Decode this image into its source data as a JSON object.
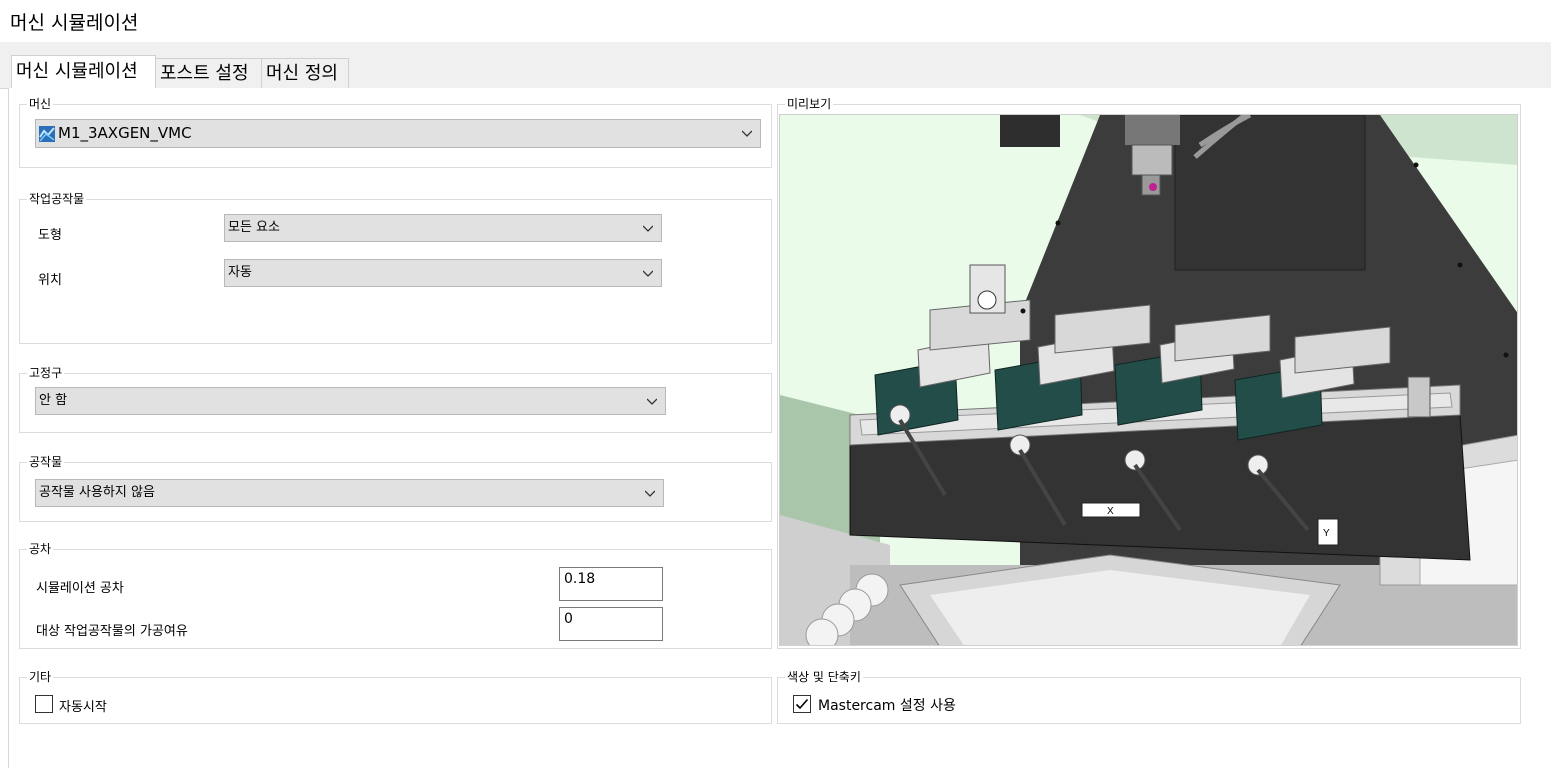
{
  "window": {
    "title": "머신 시뮬레이션"
  },
  "tabs": [
    {
      "label": "머신 시뮬레이션",
      "active": true
    },
    {
      "label": "포스트 설정",
      "active": false
    },
    {
      "label": "머신 정의",
      "active": false
    }
  ],
  "machine": {
    "group_label": "머신",
    "selected": "M1_3AXGEN_VMC",
    "icon": "machine-icon"
  },
  "workpiece": {
    "group_label": "작업공작물",
    "shape_label": "도형",
    "shape_value": "모든 요소",
    "position_label": "위치",
    "position_value": "자동"
  },
  "fixture": {
    "group_label": "고정구",
    "value": "안 함"
  },
  "stock": {
    "group_label": "공작물",
    "value": "공작물 사용하지 않음"
  },
  "tolerance": {
    "group_label": "공차",
    "sim_label": "시뮬레이션 공차",
    "sim_value": "0.18",
    "allowance_label": "대상 작업공작물의 가공여유",
    "allowance_value": "0"
  },
  "other": {
    "group_label": "기타",
    "autostart_label": "자동시작",
    "autostart_checked": false
  },
  "preview": {
    "group_label": "미리보기",
    "x_axis": "X",
    "y_axis": "Y"
  },
  "colors": {
    "group_label": "색상 및 단축키",
    "use_mastercam_label": "Mastercam 설정 사용",
    "use_mastercam_checked": true
  },
  "palette": {
    "accent_blue": "#2a6fb8",
    "vise_green": "#234d48",
    "machine_dark": "#3c3c3c",
    "background_green": "#eafbe9"
  }
}
